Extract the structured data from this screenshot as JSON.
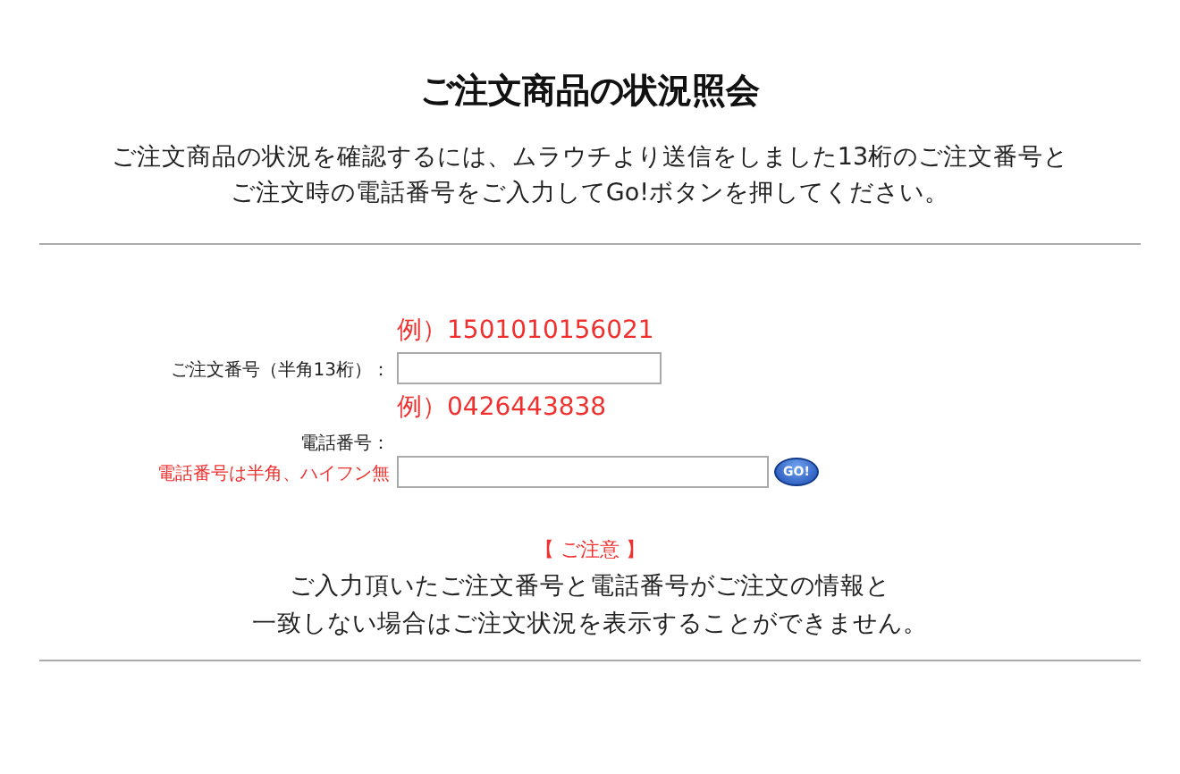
{
  "title": "ご注文商品の状況照会",
  "intro": [
    "ご注文商品の状況を確認するには、ムラウチより送信をしました13桁のご注文番号と",
    "ご注文時の電話番号をご入力してGo!ボタンを押してください。"
  ],
  "form": {
    "fields": [
      {
        "example": "例）1501010156021",
        "label": "ご注文番号（半角13桁）：",
        "has_go": false
      },
      {
        "example": "例）0426443838",
        "label": "電話番号：",
        "hint": "電話番号は半角、ハイフン無",
        "has_go": true
      }
    ],
    "go_button": "GO!"
  },
  "notice": {
    "heading": "【 ご注意 】",
    "lines": [
      "ご入力頂いたご注文番号と電話番号がご注文の情報と",
      "一致しない場合はご注文状況を表示することができません。"
    ]
  }
}
